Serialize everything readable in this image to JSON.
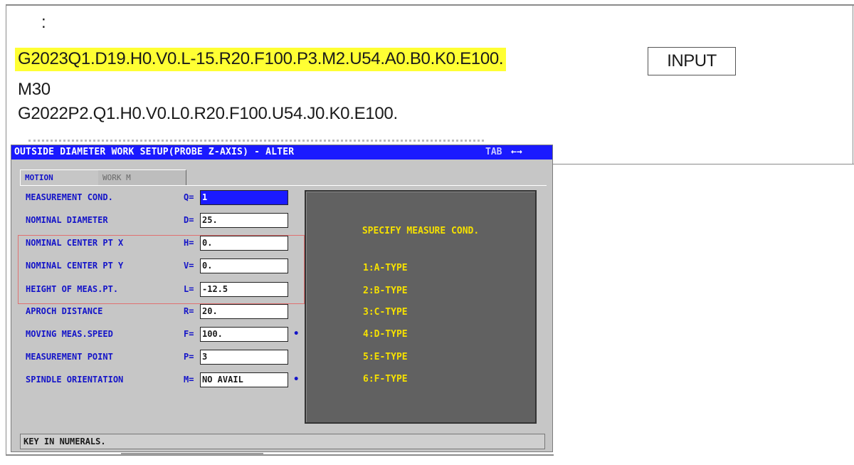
{
  "document": {
    "colon": ":",
    "line1": "G2023Q1.D19.H0.V0.L-15.R20.F100.P3.M2.U54.A0.B0.K0.E100.",
    "line2": "M30",
    "line3": "G2022P2.Q1.H0.V0.L0.R20.F100.U54.J0.K0.E100.",
    "input_button": "INPUT",
    "highlight_color": "#ffff33"
  },
  "dialog": {
    "title": "OUTSIDE DIAMETER WORK SETUP(PROBE Z-AXIS) - ALTER",
    "tab_hint": "TAB",
    "tab_arrows": "←→",
    "tabs": [
      "MOTION",
      "WORK M"
    ],
    "params": [
      {
        "label": "MEASUREMENT COND.",
        "code": "Q=",
        "value": "1",
        "selected": true
      },
      {
        "label": "NOMINAL DIAMETER",
        "code": "D=",
        "value": "25."
      },
      {
        "label": "NOMINAL CENTER PT X",
        "code": "H=",
        "value": "0."
      },
      {
        "label": "NOMINAL CENTER PT Y",
        "code": "V=",
        "value": "0."
      },
      {
        "label": "HEIGHT OF MEAS.PT.",
        "code": "L=",
        "value": "-12.5"
      },
      {
        "label": "APROCH DISTANCE",
        "code": "R=",
        "value": "20."
      },
      {
        "label": "MOVING MEAS.SPEED",
        "code": "F=",
        "value": "100.",
        "marker": "•"
      },
      {
        "label": "MEASUREMENT POINT",
        "code": "P=",
        "value": "3"
      },
      {
        "label": "SPINDLE ORIENTATION",
        "code": "M=",
        "value": "NO AVAIL",
        "marker": "•"
      }
    ],
    "help": {
      "title": "SPECIFY MEASURE COND.",
      "options": [
        "1:A-TYPE",
        "2:B-TYPE",
        "3:C-TYPE",
        "4:D-TYPE",
        "5:E-TYPE",
        "6:F-TYPE"
      ]
    },
    "status": "KEY IN NUMERALS.",
    "colors": {
      "title_bar": "#1a1aff",
      "label": "#1414c8",
      "help_text": "#f5e000",
      "help_bg": "#616161"
    }
  }
}
